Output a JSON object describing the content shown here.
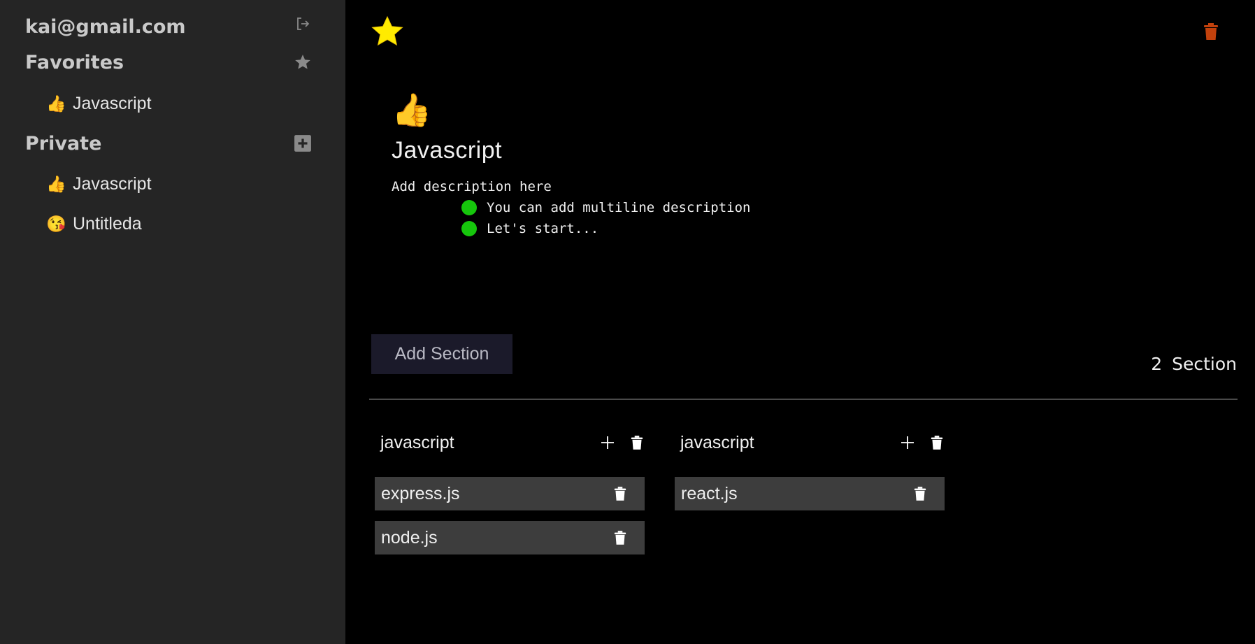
{
  "colors": {
    "sidebar_bg": "#252525",
    "main_bg": "#000000",
    "star": "#ffd700",
    "trash_top": "#d64a0f",
    "bullet": "#16c60c",
    "task_bg": "#3d3d3d",
    "add_section_bg": "#1b1a2a"
  },
  "sidebar": {
    "user_email": "kai@gmail.com",
    "logout_icon": "logout-icon",
    "favorites": {
      "title": "Favorites",
      "icon": "star-icon",
      "items": [
        {
          "emoji": "👍",
          "label": "Javascript"
        }
      ]
    },
    "private": {
      "title": "Private",
      "icon": "plus-square-icon",
      "items": [
        {
          "emoji": "👍",
          "label": "Javascript"
        },
        {
          "emoji": "😘",
          "label": "Untitleda"
        }
      ]
    }
  },
  "page": {
    "favorite_icon": "star-icon",
    "delete_icon": "trash-icon",
    "emoji": "👍",
    "title": "Javascript",
    "description": {
      "line": "Add description here",
      "bullets": [
        "You can add multiline description",
        "Let's start..."
      ]
    }
  },
  "toolbar": {
    "add_section_label": "Add Section",
    "section_count": "2",
    "section_count_label": "Section"
  },
  "sections": [
    {
      "name": "javascript",
      "tasks": [
        "express.js",
        "node.js"
      ]
    },
    {
      "name": "javascript",
      "tasks": [
        "react.js"
      ]
    }
  ]
}
